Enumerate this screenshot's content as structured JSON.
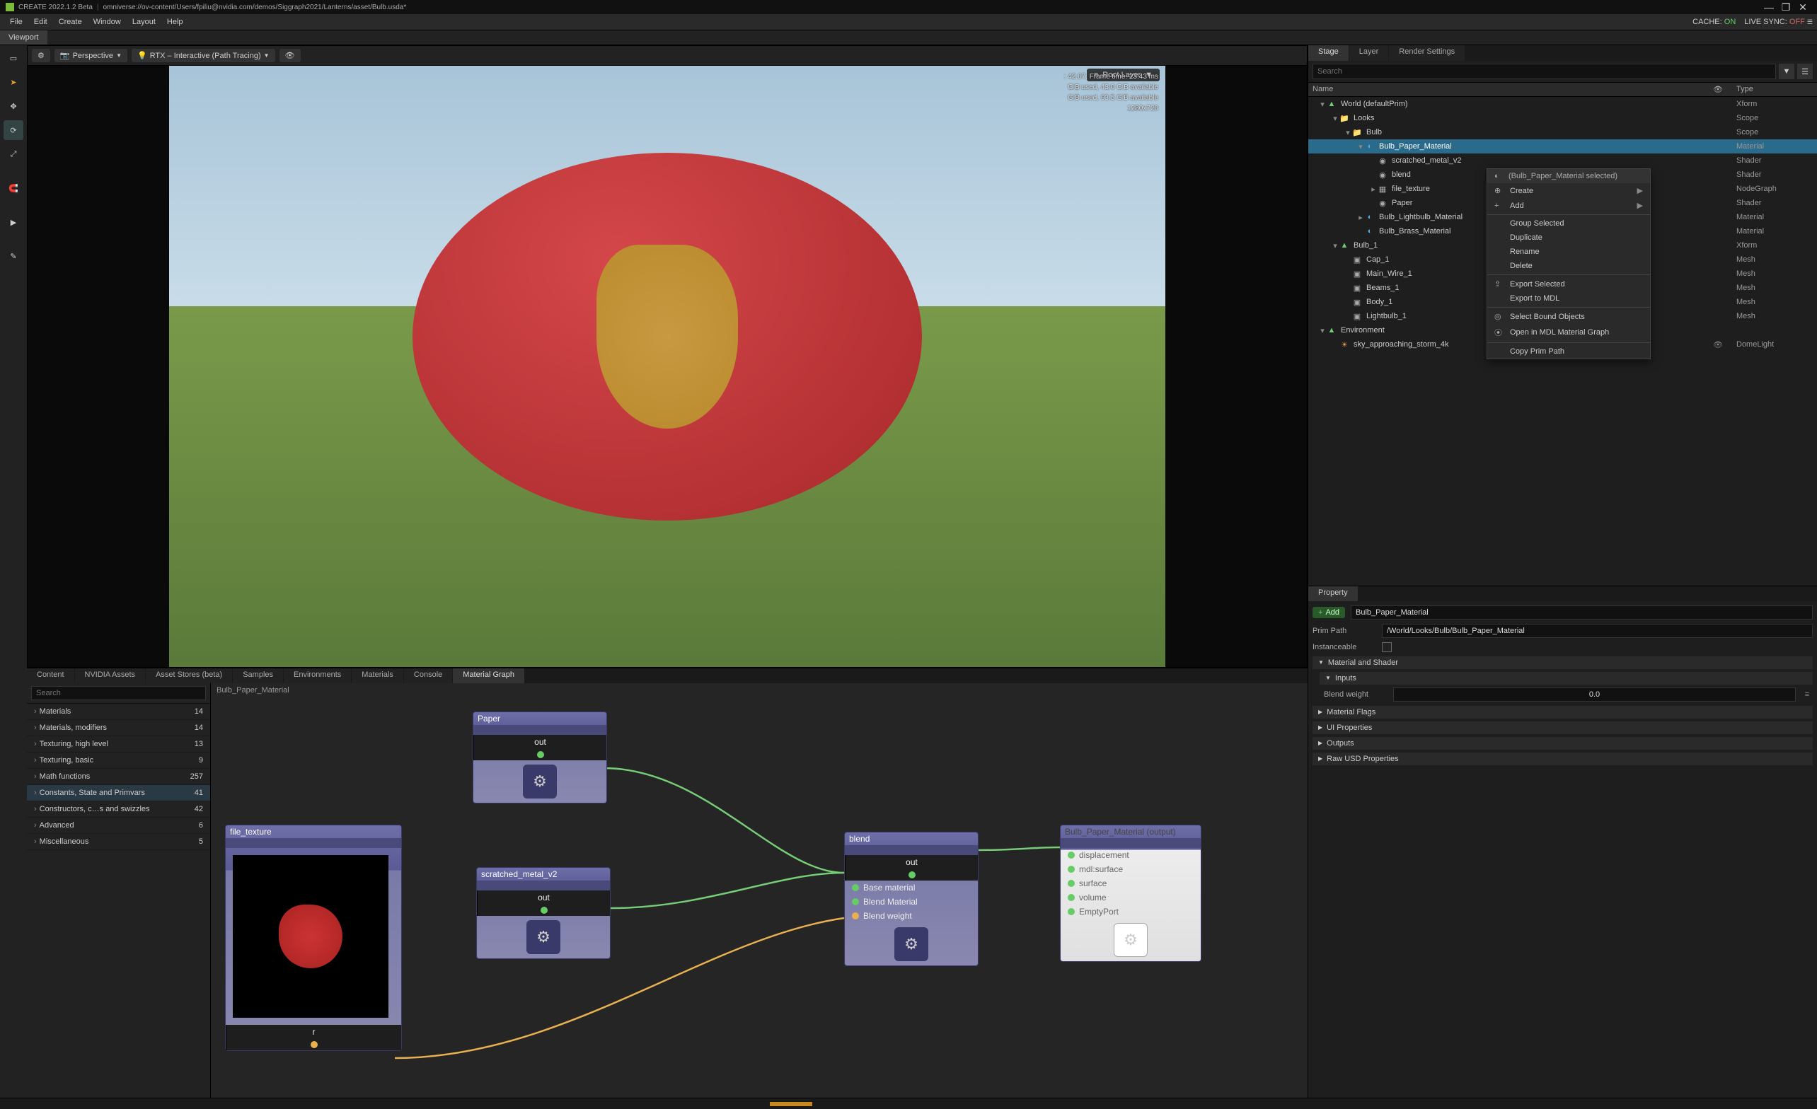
{
  "titlebar": {
    "app": "CREATE",
    "version": "2022.1.2 Beta",
    "path": "omniverse://ov-content/Users/fpiliu@nvidia.com/demos/Siggraph2021/Lanterns/asset/Bulb.usda*"
  },
  "menubar": {
    "items": [
      "File",
      "Edit",
      "Create",
      "Window",
      "Layout",
      "Help"
    ],
    "cache_label": "CACHE:",
    "cache_state": "ON",
    "livesync_label": "LIVE SYNC:",
    "livesync_state": "OFF"
  },
  "viewport_tab": "Viewport",
  "viewport_bar": {
    "camera": "Perspective",
    "renderer": "RTX – Interactive (Path Tracing)",
    "rootlayer": "Root Layer"
  },
  "viewport_overlay": {
    "line1": ": 42.67, Frame time: 23.43 ms",
    "line2": " GiB used, 43.0 GiB available",
    "line3": " GiB used, 93.5 GiB available",
    "line4": "1280x720"
  },
  "bottom_tabs": [
    "Content",
    "NVIDIA Assets",
    "Asset Stores (beta)",
    "Samples",
    "Environments",
    "Materials",
    "Console",
    "Material Graph"
  ],
  "bottom_tabs_active": "Material Graph",
  "matlib": {
    "search_placeholder": "Search",
    "items": [
      {
        "label": "Materials",
        "count": "14"
      },
      {
        "label": "Materials, modifiers",
        "count": "14"
      },
      {
        "label": "Texturing, high level",
        "count": "13"
      },
      {
        "label": "Texturing, basic",
        "count": "9"
      },
      {
        "label": "Math functions",
        "count": "257"
      },
      {
        "label": "Constants, State and Primvars",
        "count": "41",
        "sel": true
      },
      {
        "label": "Constructors, c…s and swizzles",
        "count": "42"
      },
      {
        "label": "Advanced",
        "count": "6"
      },
      {
        "label": "Miscellaneous",
        "count": "5"
      }
    ]
  },
  "graph": {
    "crumb": "Bulb_Paper_Material",
    "nodes": {
      "paper": {
        "title": "Paper",
        "out": "out"
      },
      "file_texture": {
        "title": "file_texture",
        "port": "r"
      },
      "scratched": {
        "title": "scratched_metal_v2",
        "out": "out"
      },
      "blend": {
        "title": "blend",
        "out": "out",
        "in": [
          "Base material",
          "Blend Material",
          "Blend weight"
        ]
      },
      "output": {
        "title": "Bulb_Paper_Material (output)",
        "in": [
          "displacement",
          "mdl:surface",
          "surface",
          "volume",
          "EmptyPort"
        ]
      }
    }
  },
  "right_tabs": [
    "Stage",
    "Layer",
    "Render Settings"
  ],
  "right_tabs_active": "Stage",
  "stage_search_placeholder": "Search",
  "stage_cols": {
    "name": "Name",
    "type": "Type"
  },
  "stage_tree": [
    {
      "d": 0,
      "exp": "-",
      "icon": "xform",
      "name": "World (defaultPrim)",
      "type": "Xform"
    },
    {
      "d": 1,
      "exp": "-",
      "icon": "folder",
      "name": "Looks",
      "type": "Scope"
    },
    {
      "d": 2,
      "exp": "-",
      "icon": "folder",
      "name": "Bulb",
      "type": "Scope"
    },
    {
      "d": 3,
      "exp": "-",
      "icon": "mat",
      "name": "Bulb_Paper_Material",
      "type": "Material",
      "sel": true
    },
    {
      "d": 4,
      "exp": "",
      "icon": "shader",
      "name": "scratched_metal_v2",
      "type": "Shader"
    },
    {
      "d": 4,
      "exp": "",
      "icon": "shader",
      "name": "blend",
      "type": "Shader"
    },
    {
      "d": 4,
      "exp": "+",
      "icon": "graph",
      "name": "file_texture",
      "type": "NodeGraph"
    },
    {
      "d": 4,
      "exp": "",
      "icon": "shader",
      "name": "Paper",
      "type": "Shader"
    },
    {
      "d": 3,
      "exp": "+",
      "icon": "mat",
      "name": "Bulb_Lightbulb_Material",
      "type": "Material"
    },
    {
      "d": 3,
      "exp": "",
      "icon": "mat",
      "name": "Bulb_Brass_Material",
      "type": "Material"
    },
    {
      "d": 1,
      "exp": "-",
      "icon": "xform",
      "name": "Bulb_1",
      "type": "Xform"
    },
    {
      "d": 2,
      "exp": "",
      "icon": "mesh",
      "name": "Cap_1",
      "type": "Mesh"
    },
    {
      "d": 2,
      "exp": "",
      "icon": "mesh",
      "name": "Main_Wire_1",
      "type": "Mesh"
    },
    {
      "d": 2,
      "exp": "",
      "icon": "mesh",
      "name": "Beams_1",
      "type": "Mesh"
    },
    {
      "d": 2,
      "exp": "",
      "icon": "mesh",
      "name": "Body_1",
      "type": "Mesh"
    },
    {
      "d": 2,
      "exp": "",
      "icon": "mesh",
      "name": "Lightbulb_1",
      "type": "Mesh"
    },
    {
      "d": 0,
      "exp": "-",
      "icon": "xform",
      "name": "Environment",
      "type": ""
    },
    {
      "d": 1,
      "exp": "",
      "icon": "light",
      "name": "sky_approaching_storm_4k",
      "type": "DomeLight",
      "eye": true
    }
  ],
  "ctxmenu": {
    "header": "(Bulb_Paper_Material selected)",
    "items": [
      {
        "label": "Create",
        "sub": true,
        "icon": "⊕"
      },
      {
        "label": "Add",
        "sub": true,
        "icon": "+",
        "green": true
      },
      {
        "divider": true
      },
      {
        "label": "Group Selected"
      },
      {
        "label": "Duplicate"
      },
      {
        "label": "Rename"
      },
      {
        "label": "Delete"
      },
      {
        "divider": true
      },
      {
        "label": "Export Selected",
        "icon": "⇪"
      },
      {
        "label": "Export to MDL"
      },
      {
        "divider": true
      },
      {
        "label": "Select Bound Objects",
        "icon": "◎"
      },
      {
        "label": "Open in MDL Material Graph",
        "icon": "⦿"
      },
      {
        "divider": true
      },
      {
        "label": "Copy Prim Path"
      }
    ]
  },
  "property": {
    "tab": "Property",
    "add_btn": "Add",
    "name_field": "Bulb_Paper_Material",
    "primpath_label": "Prim Path",
    "primpath_value": "/World/Looks/Bulb/Bulb_Paper_Material",
    "instanceable_label": "Instanceable",
    "sections": {
      "matshader": "Material and Shader",
      "inputs": "Inputs",
      "blend_label": "Blend weight",
      "blend_value": "0.0",
      "matflags": "Material Flags",
      "uiprops": "UI Properties",
      "outputs": "Outputs",
      "rawusd": "Raw USD Properties"
    }
  }
}
